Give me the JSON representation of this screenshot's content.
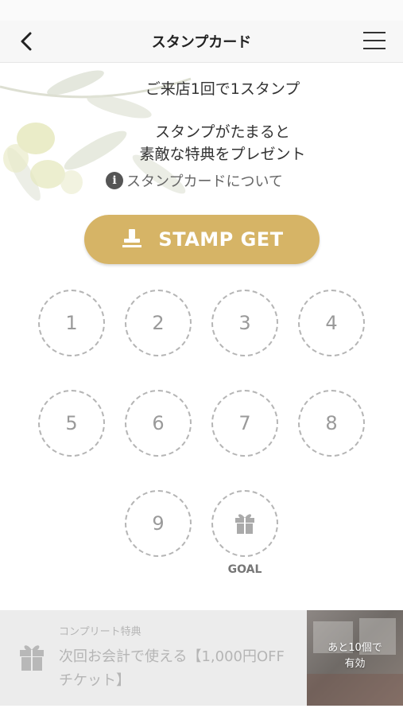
{
  "header": {
    "title": "スタンプカード"
  },
  "intro": {
    "line1": "ご来店1回で1スタンプ",
    "line2": "スタンプがたまると",
    "line3": "素敵な特典をプレゼント",
    "about_link": "スタンプカードについて"
  },
  "stamp_button": {
    "label": "STAMP GET"
  },
  "slots": [
    "1",
    "2",
    "3",
    "4",
    "5",
    "6",
    "7",
    "8",
    "9"
  ],
  "goal_label": "GOAL",
  "complete_reward": {
    "subtitle": "コンプリート特典",
    "description": "次回お会計で使える【1,000円OFFチケット】",
    "remaining_line1": "あと10個で",
    "remaining_line2": "有効"
  },
  "colors": {
    "accent": "#d6b466",
    "slot_border": "#b5b5b5"
  }
}
